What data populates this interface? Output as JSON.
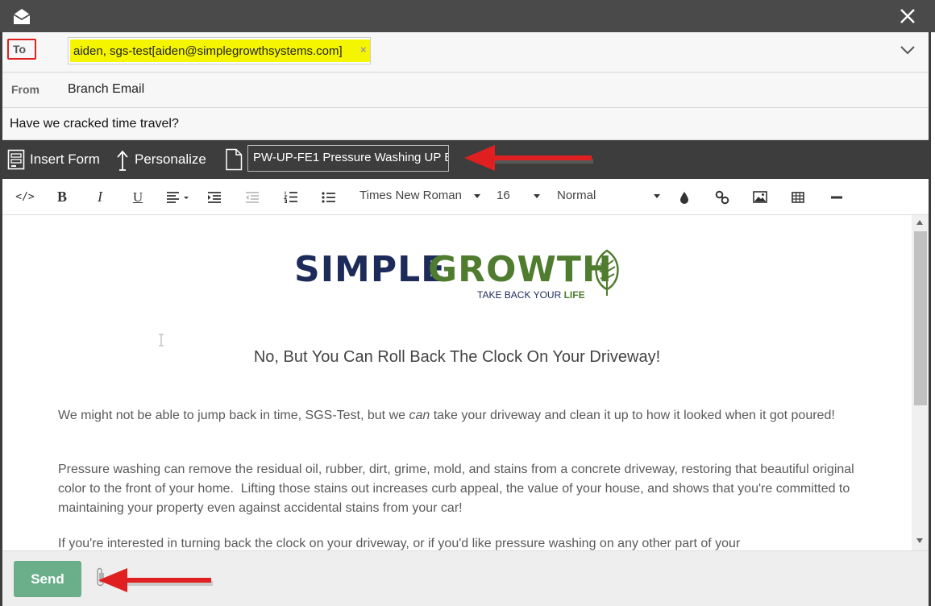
{
  "header": {
    "app_icon": "envelope-open-icon",
    "close_icon": "close-icon"
  },
  "recipients": {
    "to_label": "To",
    "chip_text": "aiden, sgs-test[aiden@simplegrowthsystems.com]",
    "chip_remove": "×",
    "expand_icon": "chevron-down-icon"
  },
  "from": {
    "label": "From",
    "value": "Branch Email"
  },
  "subject": {
    "value": "Have we cracked time travel?"
  },
  "form_bar": {
    "insert_form": "Insert Form",
    "personalize": "Personalize",
    "template_value": "PW-UP-FE1 Pressure Washing UP E"
  },
  "format_toolbar": {
    "source": "</>",
    "bold": "B",
    "italic": "I",
    "underline": "U",
    "font_family": "Times New Roman",
    "font_size": "16",
    "paragraph_style": "Normal"
  },
  "email_body": {
    "logo_word_1": "SIMPLE",
    "logo_word_2": "GROWTH",
    "logo_tagline_prefix": "TAKE BACK YOUR ",
    "logo_tagline_emphasis": "LIFE",
    "headline": "No, But You Can Roll Back The Clock On Your Driveway!",
    "p1_before": "We might not be able to jump back in time, SGS-Test, but we ",
    "p1_emphasis": "can",
    "p1_after": " take your driveway and clean it up to how it looked when it got poured!",
    "p2": "Pressure washing can remove the residual oil, rubber, dirt, grime, mold, and stains from a concrete driveway, restoring that beautiful original color to the front of your home.  Lifting those stains out increases curb appeal, the value of your house, and shows that you're committed to maintaining your property even against accidental stains from your car!",
    "p3": "If you're interested in turning back the clock on your driveway, or if you'd like pressure washing on any other part of your"
  },
  "footer": {
    "send_label": "Send",
    "attach_icon": "paperclip-icon"
  },
  "colors": {
    "titlebar": "#4a4a4a",
    "highlight": "#f5f500",
    "annotation_red": "#e02020",
    "send_green": "#6aaf8a",
    "logo_navy": "#1d2b5a",
    "logo_green": "#4f7c2f"
  }
}
